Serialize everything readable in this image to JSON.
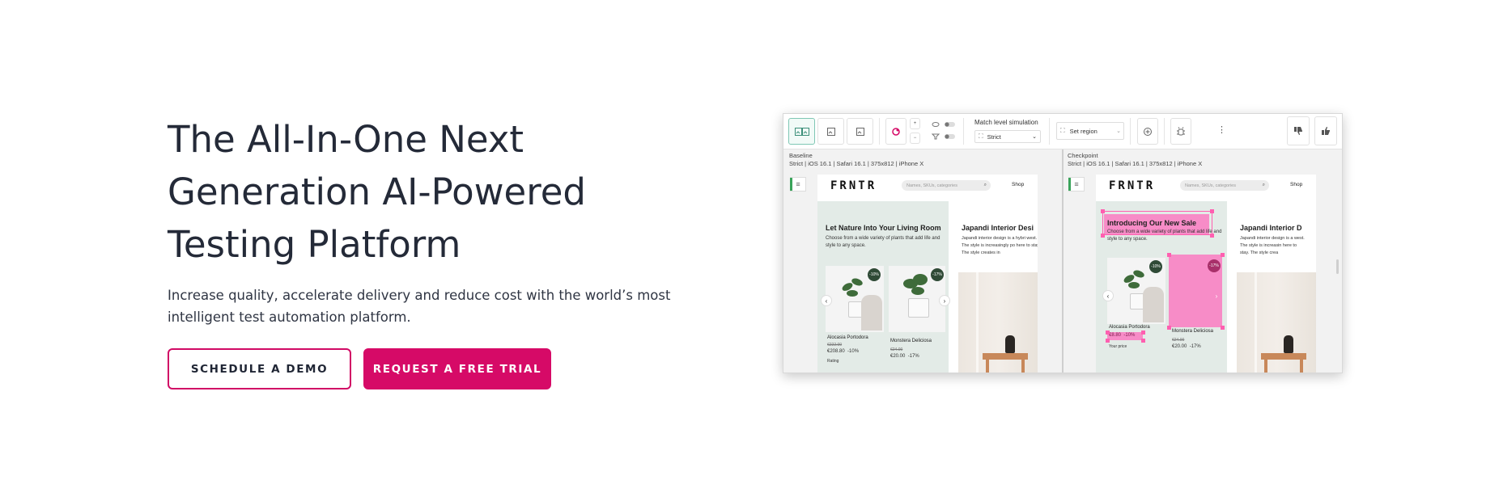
{
  "hero": {
    "headline_line1": "The All-In-One Next",
    "headline_line2": "Generation AI-Powered",
    "headline_line3": "Testing Platform",
    "subhead": "Increase quality, accelerate delivery and reduce cost with the world’s most intelligent test automation platform."
  },
  "cta": {
    "demo_label": "SCHEDULE A DEMO",
    "trial_label": "REQUEST A FREE TRIAL"
  },
  "colors": {
    "brand": "#d60a67",
    "text": "#242a38",
    "highlight": "#ff66bb",
    "accent_green": "#3aa35a"
  },
  "mockup": {
    "toolbar": {
      "match_level_label": "Match level simulation",
      "match_level_value": "Strict",
      "set_region_label": "Set region"
    },
    "baseline": {
      "title": "Baseline",
      "meta": "Strict | iOS 16.1 | Safari 16.1 | 375x812 | iPhone X"
    },
    "checkpoint": {
      "title": "Checkpoint",
      "meta": "Strict | iOS 16.1 | Safari 16.1 | 375x812 | iPhone X"
    },
    "app": {
      "logo": "FRNTR",
      "search_placeholder": "Names, SKUs, categories",
      "shop_link": "Shop",
      "baseline_hero_title": "Let Nature Into Your Living Room",
      "checkpoint_hero_title": "Introducing Our New Sale",
      "hero_body": "Choose from a wide variety of plants that add life and style to any space.",
      "side_title_baseline": "Japandi Interior Desi",
      "side_title_checkpoint": "Japandi Interior D",
      "side_body_baseline": "Japandi interior design is a hybri west. The style is increasingly po here to stay. The style creates in",
      "side_body_checkpoint": "Japandi interior design is a west. The style is increasin here to stay. The style crea",
      "products": [
        {
          "name": "Alocasia Portodora",
          "old_price": "€222.00",
          "price": "€208.80",
          "discount": "-10%",
          "badge": "-10%"
        },
        {
          "name": "Monstera Deliciosa",
          "old_price": "€24.00",
          "price": "€20.00",
          "discount": "-17%",
          "badge": "-17%"
        }
      ],
      "checkpoint_price": "€8.80",
      "your_price_label": "Your price",
      "rating_text": "Rating"
    }
  }
}
